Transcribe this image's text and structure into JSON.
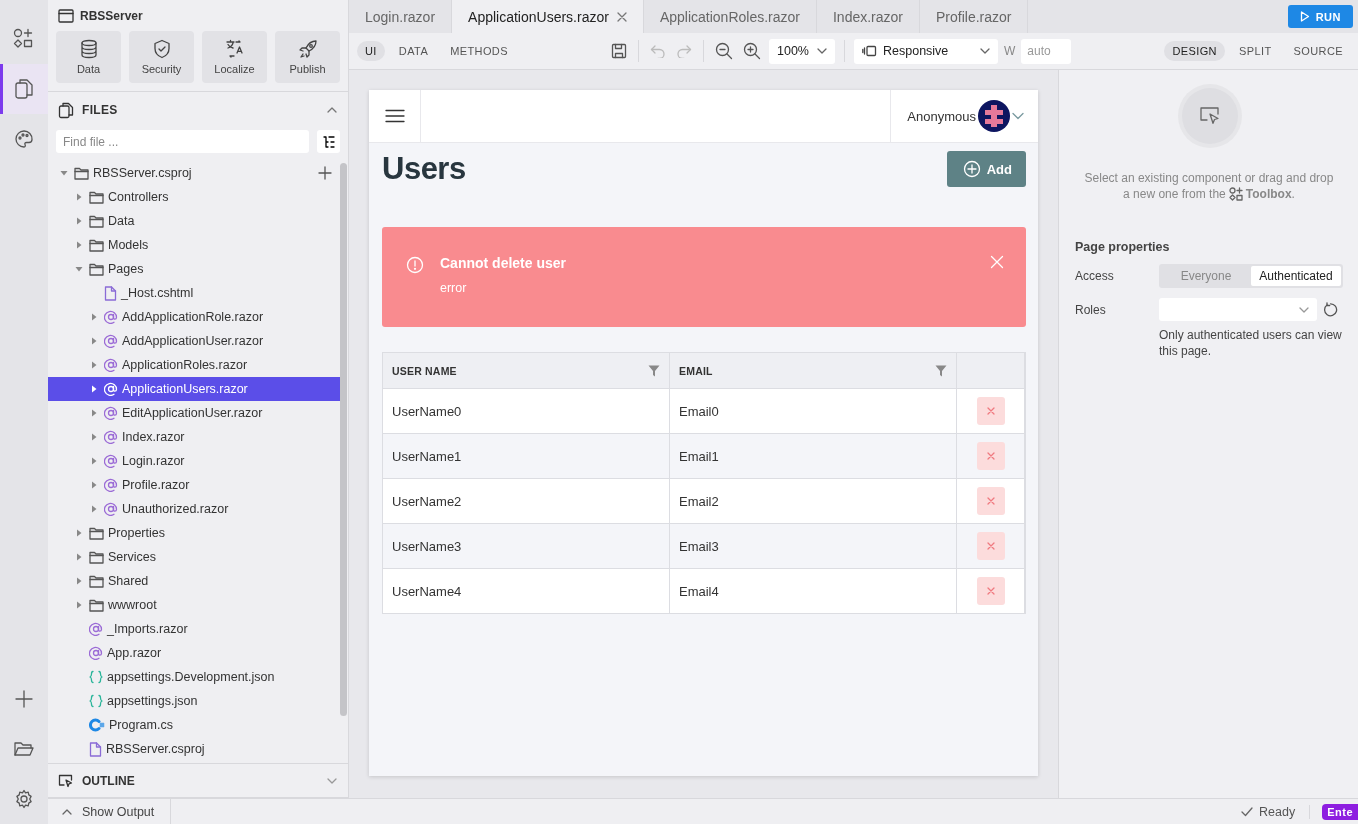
{
  "activity_bar": {
    "items": [
      {
        "kind": "toolbox",
        "selected": false
      },
      {
        "kind": "files",
        "selected": true
      },
      {
        "kind": "theme",
        "selected": false
      }
    ],
    "bottom_items": [
      {
        "kind": "add"
      },
      {
        "kind": "folder"
      },
      {
        "kind": "settings"
      }
    ]
  },
  "sidebar": {
    "project": "RBSServer",
    "tools": [
      {
        "kind": "data",
        "label": "Data"
      },
      {
        "kind": "security",
        "label": "Security"
      },
      {
        "kind": "localize",
        "label": "Localize"
      },
      {
        "kind": "publish",
        "label": "Publish"
      }
    ],
    "files": {
      "title": "FILES",
      "expanded": true,
      "search": {
        "placeholder": "Find file ..."
      },
      "tree": [
        {
          "label": "RBSServer.csproj",
          "kind": "project",
          "expanded": true,
          "selected": false,
          "children": [
            {
              "label": "Controllers",
              "kind": "folder",
              "expanded": false,
              "selected": false
            },
            {
              "label": "Data",
              "kind": "folder",
              "expanded": false,
              "selected": false
            },
            {
              "label": "Models",
              "kind": "folder",
              "expanded": false,
              "selected": false
            },
            {
              "label": "Pages",
              "kind": "folder",
              "expanded": true,
              "selected": false,
              "children": [
                {
                  "label": "_Host.cshtml",
                  "kind": "page",
                  "selected": false
                },
                {
                  "label": "AddApplicationRole.razor",
                  "kind": "razor",
                  "expanded": false,
                  "selected": false
                },
                {
                  "label": "AddApplicationUser.razor",
                  "kind": "razor",
                  "expanded": false,
                  "selected": false
                },
                {
                  "label": "ApplicationRoles.razor",
                  "kind": "razor",
                  "expanded": false,
                  "selected": false
                },
                {
                  "label": "ApplicationUsers.razor",
                  "kind": "razor",
                  "expanded": false,
                  "selected": true
                },
                {
                  "label": "EditApplicationUser.razor",
                  "kind": "razor",
                  "expanded": false,
                  "selected": false
                },
                {
                  "label": "Index.razor",
                  "kind": "razor",
                  "expanded": false,
                  "selected": false
                },
                {
                  "label": "Login.razor",
                  "kind": "razor",
                  "expanded": false,
                  "selected": false
                },
                {
                  "label": "Profile.razor",
                  "kind": "razor",
                  "expanded": false,
                  "selected": false
                },
                {
                  "label": "Unauthorized.razor",
                  "kind": "razor",
                  "expanded": false,
                  "selected": false
                }
              ]
            },
            {
              "label": "Properties",
              "kind": "folder",
              "expanded": false,
              "selected": false
            },
            {
              "label": "Services",
              "kind": "folder",
              "expanded": false,
              "selected": false
            },
            {
              "label": "Shared",
              "kind": "folder",
              "expanded": false,
              "selected": false
            },
            {
              "label": "wwwroot",
              "kind": "folder",
              "expanded": false,
              "selected": false
            },
            {
              "label": "_Imports.razor",
              "kind": "razor",
              "selected": false
            },
            {
              "label": "App.razor",
              "kind": "razor",
              "selected": false
            },
            {
              "label": "appsettings.Development.json",
              "kind": "json",
              "selected": false
            },
            {
              "label": "appsettings.json",
              "kind": "json",
              "selected": false
            },
            {
              "label": "Program.cs",
              "kind": "csharp",
              "selected": false
            },
            {
              "label": "RBSServer.csproj",
              "kind": "page",
              "selected": false
            }
          ]
        }
      ]
    },
    "outline": {
      "title": "OUTLINE",
      "expanded": false
    }
  },
  "tabs": [
    {
      "label": "Login.razor",
      "selected": false
    },
    {
      "label": "ApplicationUsers.razor",
      "selected": true
    },
    {
      "label": "ApplicationRoles.razor",
      "selected": false
    },
    {
      "label": "Index.razor",
      "selected": false
    },
    {
      "label": "Profile.razor",
      "selected": false
    }
  ],
  "run_button": "RUN",
  "toolbar": {
    "views": [
      {
        "label": "UI",
        "selected": true
      },
      {
        "label": "DATA",
        "selected": false
      },
      {
        "label": "METHODS",
        "selected": false
      }
    ],
    "undo_disabled": true,
    "redo_disabled": true,
    "zoom": "100%",
    "device": "Responsive",
    "width_label": "W",
    "width": {
      "placeholder": "auto"
    },
    "modes": [
      {
        "label": "DESIGN",
        "selected": true
      },
      {
        "label": "SPLIT",
        "selected": false
      },
      {
        "label": "SOURCE",
        "selected": false
      }
    ]
  },
  "page": {
    "user": "Anonymous",
    "title": "Users",
    "add_button": "Add",
    "alert": {
      "title": "Cannot delete user",
      "message": "error"
    },
    "table": {
      "columns": [
        {
          "label": "USER NAME",
          "filter": true
        },
        {
          "label": "EMAIL",
          "filter": true
        },
        {}
      ],
      "rows": [
        [
          "UserName0",
          "Email0"
        ],
        [
          "UserName1",
          "Email1"
        ],
        [
          "UserName2",
          "Email2"
        ],
        [
          "UserName3",
          "Email3"
        ],
        [
          "UserName4",
          "Email4"
        ]
      ]
    }
  },
  "properties": {
    "hint": [
      "Select an existing component or drag and drop",
      "a new one from the"
    ],
    "hint_link": "**Toolbox**.",
    "title": "Page properties",
    "access_label": "Access",
    "access_options": [
      {
        "label": "Everyone",
        "selected": false
      },
      {
        "label": "Authenticated",
        "selected": true
      }
    ],
    "roles_label": "Roles",
    "note": "Only authenticated users can view this page."
  },
  "status_bar": {
    "output": "Show Output",
    "status": "Ready",
    "badge": "Ente"
  }
}
